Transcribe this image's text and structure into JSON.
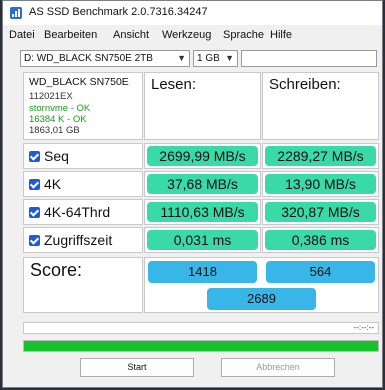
{
  "window": {
    "title": "AS SSD Benchmark 2.0.7316.34247"
  },
  "menu": [
    "Datei",
    "Bearbeiten",
    "Ansicht",
    "Werkzeug",
    "Sprache",
    "Hilfe"
  ],
  "toolbar": {
    "drive": "D: WD_BLACK SN750E 2TB",
    "size": "1 GB"
  },
  "drive_info": {
    "name": "WD_BLACK SN750E",
    "firmware": "112021EX",
    "driver": "stornvme - OK",
    "alignment": "16384 K - OK",
    "capacity": "1863,01 GB"
  },
  "columns": {
    "read": "Lesen:",
    "write": "Schreiben:"
  },
  "tests": [
    {
      "name": "Seq",
      "read": "2699,99 MB/s",
      "write": "2289,27 MB/s"
    },
    {
      "name": "4K",
      "read": "37,68 MB/s",
      "write": "13,90 MB/s"
    },
    {
      "name": "4K-64Thrd",
      "read": "1110,63 MB/s",
      "write": "320,87 MB/s"
    },
    {
      "name": "Zugriffszeit",
      "read": "0,031 ms",
      "write": "0,386 ms"
    }
  ],
  "score": {
    "label": "Score:",
    "read": "1418",
    "write": "564",
    "total": "2689"
  },
  "timer": "--:--:--",
  "progress": {
    "percent": 100,
    "color": "#16c12c"
  },
  "buttons": {
    "start": "Start",
    "cancel": "Abbrechen"
  },
  "colors": {
    "result": "#3ad9a8",
    "score": "#38b6e8",
    "checkbox": "#1e5bd6"
  }
}
